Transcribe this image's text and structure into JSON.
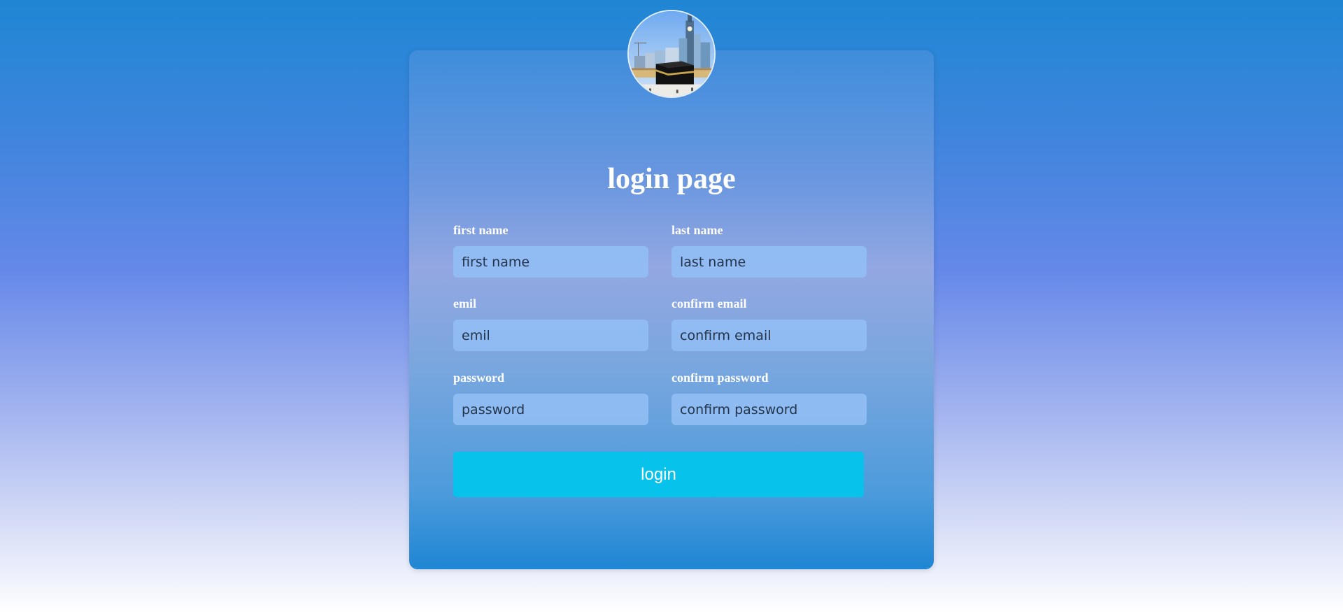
{
  "page": {
    "title": "login page"
  },
  "form": {
    "first_name": {
      "label": "first name",
      "placeholder": "first name"
    },
    "last_name": {
      "label": "last name",
      "placeholder": "last name"
    },
    "email": {
      "label": "emil",
      "placeholder": "emil"
    },
    "confirm_email": {
      "label": "confirm email",
      "placeholder": "confirm email"
    },
    "password": {
      "label": "password",
      "placeholder": "password"
    },
    "confirm_password": {
      "label": "confirm password",
      "placeholder": "confirm password"
    },
    "submit_label": "login"
  },
  "colors": {
    "button": "#07c2ea",
    "input_background": "#92bef5",
    "text_light": "#ffffff"
  },
  "icons": {
    "avatar": "kaaba-photo-avatar"
  }
}
